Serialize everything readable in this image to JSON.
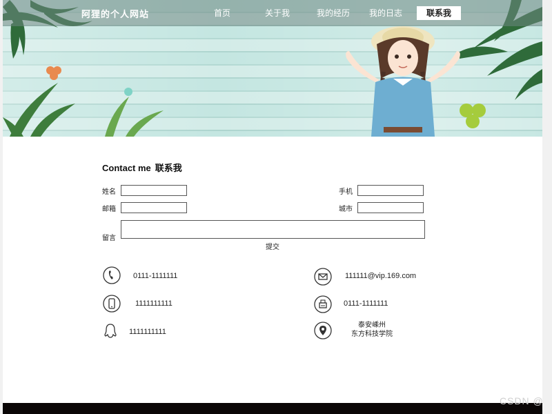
{
  "header": {
    "site_title": "阿狸的个人网站",
    "nav": [
      {
        "label": "首页"
      },
      {
        "label": "关于我"
      },
      {
        "label": "我的经历"
      },
      {
        "label": "我的日志"
      },
      {
        "label": "联系我",
        "active": true
      }
    ]
  },
  "contact": {
    "title_en": "Contact me",
    "title_zh": "联系我",
    "fields": {
      "name_label": "姓名",
      "phone_label": "手机",
      "email_label": "邮箱",
      "city_label": "城市",
      "message_label": "留言"
    },
    "submit_label": "提交"
  },
  "info": {
    "telephone": "0111-1111111",
    "email": "111111@vip.169.com",
    "mobile": "1111111111",
    "fax": "0111-1111111",
    "qq": "1111111111",
    "address_line1": "泰安嵊州",
    "address_line2": "东方科技学院"
  },
  "watermark": "CSDN @",
  "colors": {
    "banner_wood": "#c4e6e1",
    "footer": "#0a0606",
    "active_nav_bg": "#ffffff"
  }
}
